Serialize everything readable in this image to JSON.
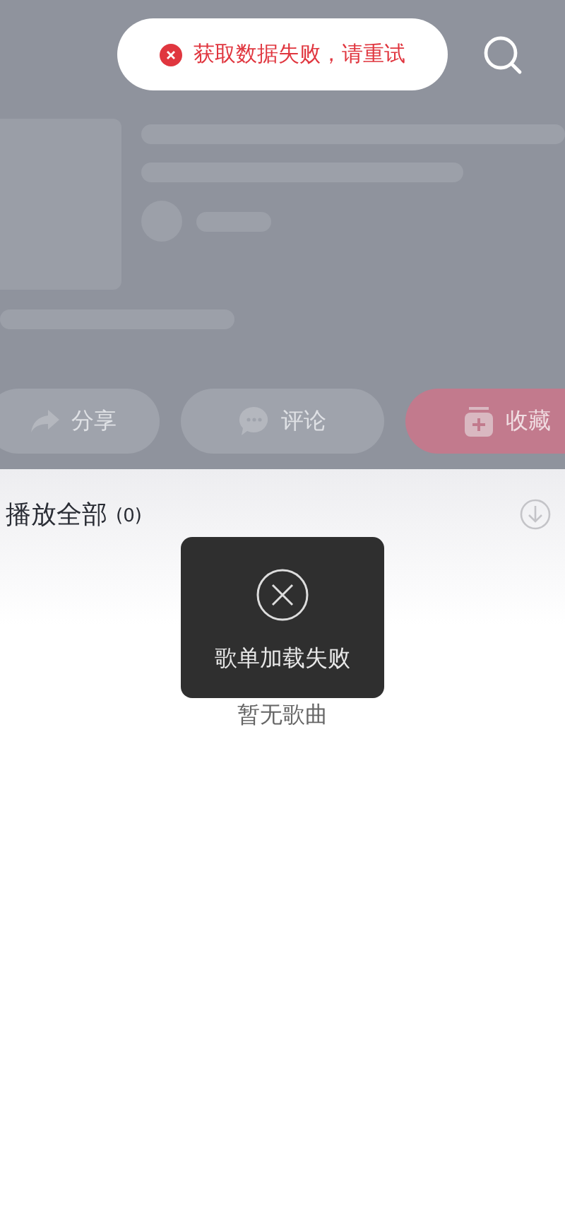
{
  "top_toast": {
    "kind": "error",
    "message": "获取数据失败，请重试"
  },
  "actions": [
    {
      "kind": "share",
      "label": "分享"
    },
    {
      "kind": "comment",
      "label": "评论"
    },
    {
      "kind": "collect",
      "label": "收藏"
    }
  ],
  "list_header": {
    "title": "播放全部",
    "count": "(0)"
  },
  "empty_message": "暂无歌曲",
  "center_toast": {
    "kind": "error",
    "message": "歌单加载失败"
  }
}
